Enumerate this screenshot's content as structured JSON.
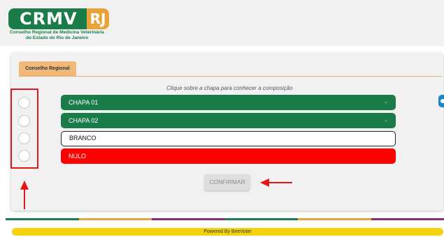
{
  "header": {
    "logo_main": "CRMV",
    "logo_badge": "RJ",
    "logo_line1": "Conselho Regional de Medicina Veterinária",
    "logo_line2": "do Estado do Rio de Janeiro"
  },
  "tabs": [
    {
      "label": "Conselho Regional"
    }
  ],
  "main": {
    "hint": "Clique sobre a chapa para conhecer a composição",
    "options": [
      {
        "label": "CHAPA 01",
        "color": "#1a7d49",
        "expandable": true
      },
      {
        "label": "CHAPA 02",
        "color": "#1a7d49",
        "expandable": true
      },
      {
        "label": "BRANCO",
        "color": "#ffffff",
        "expandable": false
      },
      {
        "label": "NULO",
        "color": "#ff0000",
        "expandable": false
      }
    ],
    "confirm_label": "CONFIRMAR"
  },
  "footer": {
    "text": "Powered By BeeVoter",
    "stripe_colors": [
      "#1a7d49",
      "#e8a33a",
      "#8b2a6e",
      "#1a7d49",
      "#e8a33a",
      "#8b2a6e"
    ]
  },
  "icons": {
    "chevron": "chevron-down-icon",
    "side_button": "accessibility-icon"
  },
  "colors": {
    "brand_green": "#1a7d49",
    "brand_orange": "#e8a33a",
    "annotation_red": "#e01818",
    "footer_yellow": "#f4d20e"
  }
}
